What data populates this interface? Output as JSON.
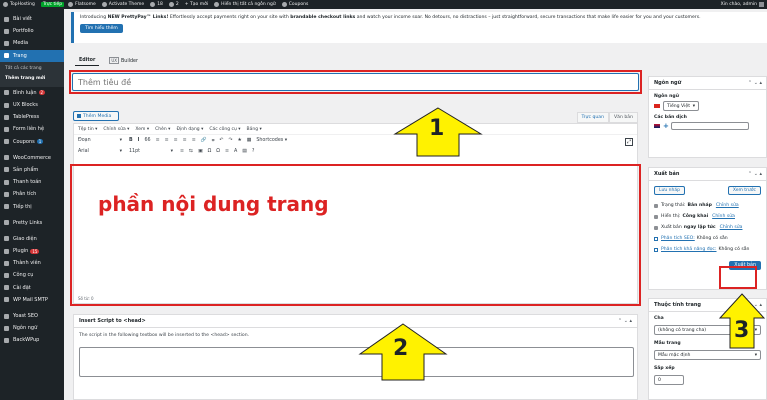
{
  "adminbar": {
    "site": "TopHosting",
    "live_badge": "Trực tiếp",
    "items": [
      "Flatsome",
      "Activate Theme",
      "18",
      "2",
      "Tạo mới",
      "Hiển thị tất cả ngôn ngữ",
      "Coupons"
    ],
    "greeting": "Xin chào, admin"
  },
  "sidebar": {
    "items_top": [
      "Bài viết",
      "Portfolio",
      "Media"
    ],
    "active": "Trang",
    "sub_items": [
      "Tất cả các trang",
      "Thêm trang mới"
    ],
    "items_mid": [
      {
        "label": "Bình luận",
        "badge": "2"
      },
      {
        "label": "UX Blocks"
      },
      {
        "label": "TablePress"
      },
      {
        "label": "Form liên hệ"
      },
      {
        "label": "Coupons",
        "badge": "1"
      },
      {
        "label": "WooCommerce"
      },
      {
        "label": "Sản phẩm"
      },
      {
        "label": "Thanh toán"
      },
      {
        "label": "Phân tích"
      },
      {
        "label": "Tiếp thị"
      },
      {
        "label": "Pretty Links"
      },
      {
        "label": "Giao diện"
      },
      {
        "label": "Plugin",
        "badge": "15"
      },
      {
        "label": "Thành viên"
      },
      {
        "label": "Công cụ"
      },
      {
        "label": "Cài đặt"
      },
      {
        "label": "WP Mail SMTP"
      },
      {
        "label": "Yoast SEO"
      },
      {
        "label": "Ngôn ngữ"
      },
      {
        "label": "BackWPup"
      }
    ]
  },
  "notice": {
    "pre": "Introducing ",
    "brand": "NEW PrettyPay™ Links!",
    "mid": " Effortlessly accept payments right on your site with ",
    "bold2": "brandable checkout links",
    "post": " and watch your income soar. No detours, no distractions – just straightforward, secure transactions that make life easier for you and your customers.",
    "button": "Tìm hiểu thêm"
  },
  "editor_tabs": {
    "editor": "Editor",
    "ux_tag": "UX",
    "builder": "Builder"
  },
  "title": {
    "placeholder": "Thêm tiêu đề"
  },
  "media_button": "Thêm Media",
  "mode_tabs": {
    "visual": "Trực quan",
    "text": "Văn bản"
  },
  "menubar": [
    "Tệp tin ▾",
    "Chỉnh sửa ▾",
    "Xem ▾",
    "Chèn ▾",
    "Định dạng ▾",
    "Các công cụ ▾",
    "Bảng ▾"
  ],
  "toolbar1": {
    "format": "Đoạn",
    "items": [
      "B",
      "I",
      "66",
      "≡",
      "≡",
      "≡",
      "≡",
      "≡",
      "🔗",
      "⌗",
      "↶",
      "↷",
      "★",
      "▦"
    ],
    "shortcodes": "Shortcodes ▾"
  },
  "toolbar2": {
    "font": "Arial",
    "size": "11pt",
    "items": [
      "≡",
      "⇆",
      "▣",
      "Ω",
      "Ω",
      "≡",
      "A",
      "▤",
      "?"
    ]
  },
  "content_text": "phần nội dung trang",
  "word_count": "Số từ: 0",
  "script_box": {
    "title": "Insert Script to <head>",
    "desc": "The script in the following textbox will be inserted to the <head> section."
  },
  "lang_panel": {
    "title": "Ngôn ngữ",
    "label": "Ngôn ngữ",
    "selected": "Tiếng Việt",
    "translations_label": "Các bản dịch"
  },
  "publish_panel": {
    "title": "Xuất bản",
    "draft_button": "Lưu nháp",
    "preview_button": "Xem trước",
    "status_label": "Trạng thái:",
    "status_value": "Bản nháp",
    "edit": "Chỉnh sửa",
    "visibility_label": "Hiển thị:",
    "visibility_value": "Công khai",
    "publish_time_prefix": "Xuất bản",
    "publish_time_value": "ngay lập tức",
    "seo_link": "Phân tích SEO:",
    "seo_value": "Không có sẵn",
    "read_link": "Phân tích khả năng đọc:",
    "read_value": "Không có sẵn",
    "publish_button": "Xuất bản"
  },
  "attr_panel": {
    "title": "Thuộc tính trang",
    "parent_label": "Cha",
    "parent_value": "(không có trang cha)",
    "template_label": "Mẫu trang",
    "template_value": "Mẫu mặc định",
    "order_label": "Sắp xếp",
    "order_value": "0"
  },
  "annotations": {
    "arrow1": "1",
    "arrow2": "2",
    "arrow3": "3"
  },
  "colors": {
    "highlight": "#dc2323",
    "arrow_fill": "#fff200",
    "accent": "#2271b1"
  }
}
